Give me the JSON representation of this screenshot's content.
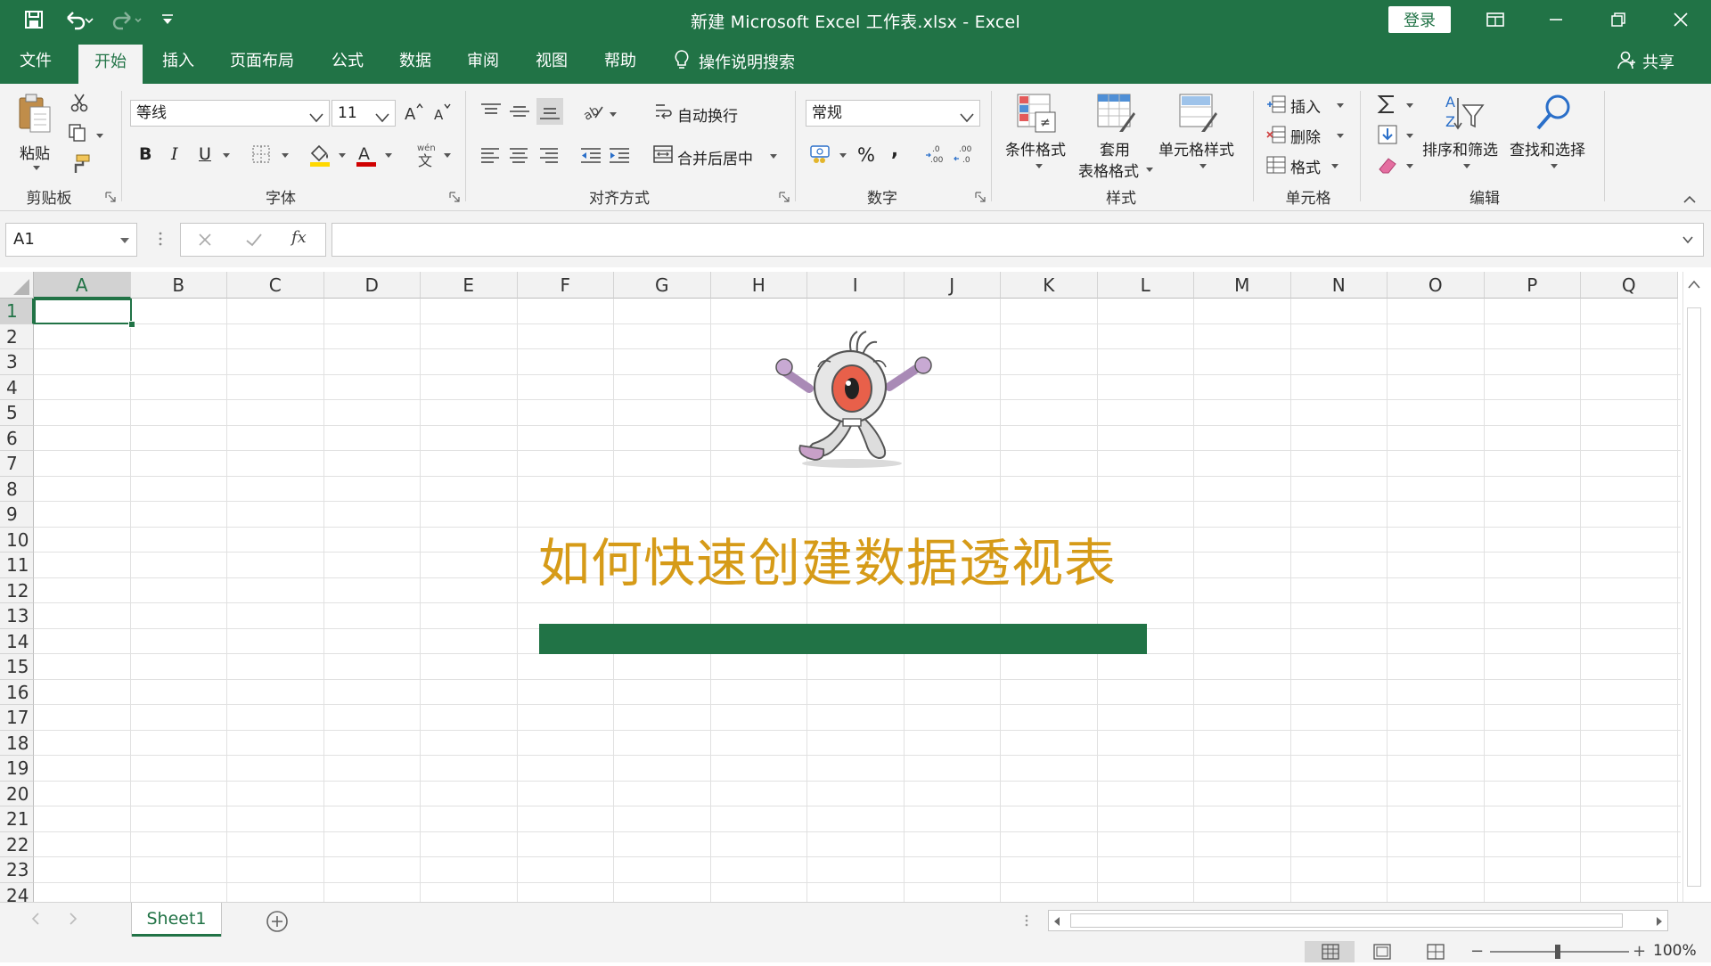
{
  "window": {
    "title": "新建 Microsoft Excel 工作表.xlsx  -  Excel",
    "login_label": "登录"
  },
  "tabs": [
    {
      "label": "文件"
    },
    {
      "label": "开始",
      "active": true
    },
    {
      "label": "插入"
    },
    {
      "label": "页面布局"
    },
    {
      "label": "公式"
    },
    {
      "label": "数据"
    },
    {
      "label": "审阅"
    },
    {
      "label": "视图"
    },
    {
      "label": "帮助"
    }
  ],
  "search_tab": {
    "label": "操作说明搜索",
    "icon": "lightbulb-icon"
  },
  "share": {
    "label": "共享",
    "icon": "person-icon"
  },
  "ribbon": {
    "clipboard": {
      "paste": "粘贴",
      "group": "剪贴板"
    },
    "font": {
      "font_name": "等线",
      "font_size": "11",
      "group": "字体",
      "bold": "B",
      "italic": "I",
      "underline": "U",
      "font_color": "#d00000",
      "fill_color": "#ffd800"
    },
    "alignment": {
      "wrap_text": "自动换行",
      "merge_center": "合并后居中",
      "group": "对齐方式"
    },
    "number": {
      "format": "常规",
      "percent": "%",
      "comma": ",",
      "group": "数字"
    },
    "styles": {
      "conditional": "条件格式",
      "table_format_1": "套用",
      "table_format_2": "表格格式",
      "cell_styles": "单元格样式",
      "group": "样式"
    },
    "cells": {
      "insert": "插入",
      "delete": "删除",
      "format": "格式",
      "group": "单元格"
    },
    "editing": {
      "sort_filter": "排序和筛选",
      "find_select": "查找和选择",
      "group": "编辑"
    }
  },
  "formula_bar": {
    "name_box": "A1",
    "formula": "",
    "fx": "fx"
  },
  "grid": {
    "columns": [
      "A",
      "B",
      "C",
      "D",
      "E",
      "F",
      "G",
      "H",
      "I",
      "J",
      "K",
      "L",
      "M",
      "N",
      "O",
      "P",
      "Q"
    ],
    "rows": [
      "1",
      "2",
      "3",
      "4",
      "5",
      "6",
      "7",
      "8",
      "9",
      "10",
      "11",
      "12",
      "13",
      "14",
      "15",
      "16",
      "17",
      "18",
      "19",
      "20",
      "21",
      "22",
      "23",
      "24"
    ],
    "selected_cell": "A1"
  },
  "overlay": {
    "title": "如何快速创建数据透视表",
    "title_color": "#d69b18",
    "progress_fraction": 1.0,
    "progress_color": "#217346"
  },
  "sheets": [
    {
      "label": "Sheet1",
      "active": true
    }
  ],
  "status": {
    "zoom": "100%"
  },
  "colors": {
    "accent": "#217346"
  }
}
